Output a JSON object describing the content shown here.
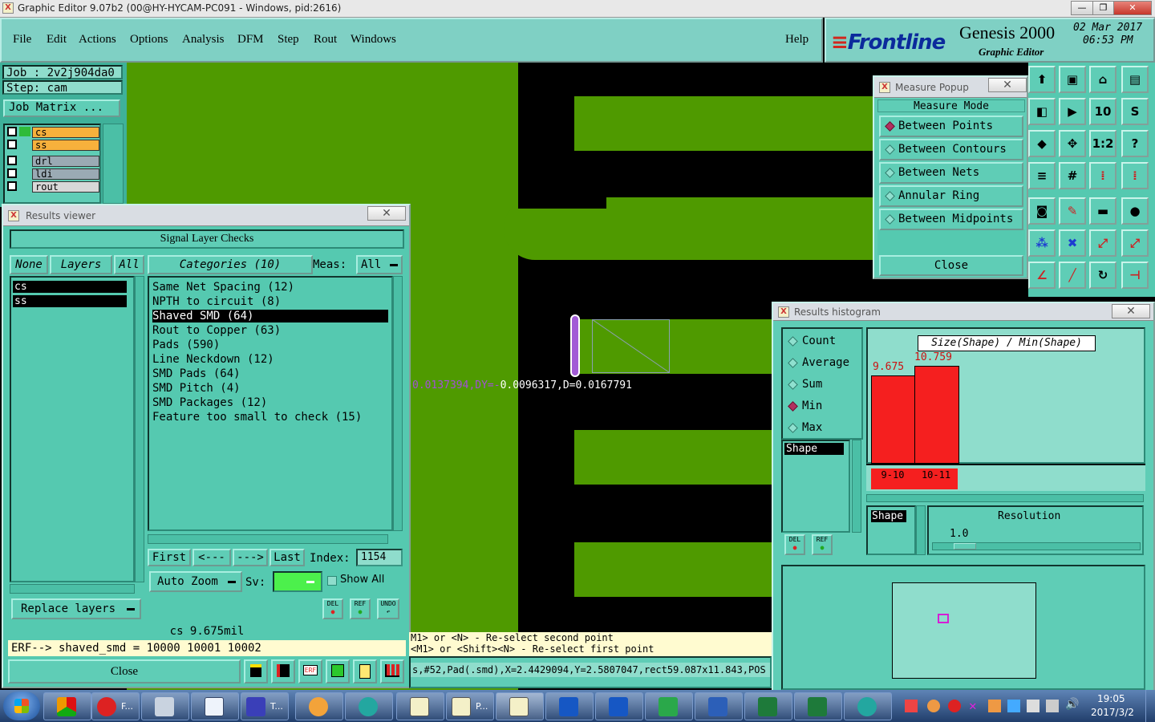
{
  "window": {
    "title": "Graphic Editor 9.07b2 (00@HY-HYCAM-PC091 - Windows, pid:2616)",
    "buttons": [
      "—",
      "❐",
      "✕"
    ]
  },
  "menu": {
    "items": [
      "File",
      "Edit",
      "Actions",
      "Options",
      "Analysis",
      "DFM",
      "Step",
      "Rout",
      "Windows"
    ],
    "help": "Help"
  },
  "brand": {
    "logo": "Frontline",
    "product": "Genesis 2000",
    "subtitle": "Graphic Editor",
    "date": "02 Mar 2017",
    "time": "06:53 PM"
  },
  "job": {
    "job_label": "Job : 2v2j904da0",
    "step_label": "Step: cam",
    "matrix_button": "Job Matrix ..."
  },
  "layers": [
    {
      "name": "cs",
      "color": "#f7b13c"
    },
    {
      "name": "ss",
      "color": "#f7b13c"
    },
    {
      "name": "drl",
      "color": "#9aaab4"
    },
    {
      "name": "ldi",
      "color": "#9aaab4"
    },
    {
      "name": "rout",
      "color": "#d8d8d8"
    }
  ],
  "measure_readout": {
    "left": "0.0137394,DY=-",
    "right": "0.0096317,D=0.0167791"
  },
  "results_viewer": {
    "title": "Results viewer",
    "close_x": "✕",
    "header": "Signal Layer Checks",
    "btn_none": "None",
    "btn_layers": "Layers",
    "btn_all": "All",
    "categories_label": "Categories (10)",
    "meas_label": "Meas:",
    "meas_value": "All",
    "layer_list": [
      "cs",
      "ss"
    ],
    "categories": [
      "Same Net Spacing (12)",
      "NPTH to circuit (8)",
      "Shaved SMD (64)",
      "Rout to Copper (63)",
      "Pads (590)",
      "Line Neckdown (12)",
      "SMD Pads (64)",
      "SMD Pitch (4)",
      "SMD Packages (12)",
      "Feature too small to check (15)"
    ],
    "selected_category_index": 2,
    "nav": {
      "first": "First",
      "prev": "<---",
      "next": "--->",
      "last": "Last",
      "index_label": "Index:",
      "index_value": "1154"
    },
    "auto_zoom": "Auto Zoom",
    "sv_label": "Sv:",
    "show_all": "Show All",
    "replace_layers": "Replace layers",
    "small_btns": [
      "DEL",
      "REF",
      "UNDO"
    ],
    "status_layer": "cs 9.675mil",
    "erf_line": "ERF--> shaved_smd = 10000 10001 10002",
    "close": "Close"
  },
  "measure_popup": {
    "title": "Measure Popup",
    "close_x": "✕",
    "mode_label": "Measure Mode",
    "options": [
      "Between Points",
      "Between Contours",
      "Between Nets",
      "Annular Ring",
      "Between Midpoints"
    ],
    "selected": 0,
    "close": "Close"
  },
  "histogram": {
    "title": "Results histogram",
    "close_x": "✕",
    "stats": [
      "Count",
      "Average",
      "Sum",
      "Min",
      "Max"
    ],
    "selected_stat": 3,
    "list_item": "Shape",
    "bar_title": "Size(Shape) / Min(Shape)",
    "bins": [
      {
        "label": "9-10",
        "value": "9.675"
      },
      {
        "label": "10-11",
        "value": "10.759"
      }
    ],
    "axis_field": "Shape",
    "resolution_label": "Resolution",
    "resolution_value": "1.0",
    "small_btns": [
      "DEL",
      "REF"
    ]
  },
  "hints": {
    "line1": "M1> or <N> - Re-select second point",
    "line2": "<M1> or <Shift><N> - Re-select first point",
    "feature": "s,#52,Pad(.smd),X=2.4429094,Y=2.5807047,rect59.087x11.843,POS"
  },
  "taskbar": {
    "items": [
      "F...",
      "T...",
      "P..."
    ],
    "clock_time": "19:05",
    "clock_date": "2017/3/2"
  }
}
